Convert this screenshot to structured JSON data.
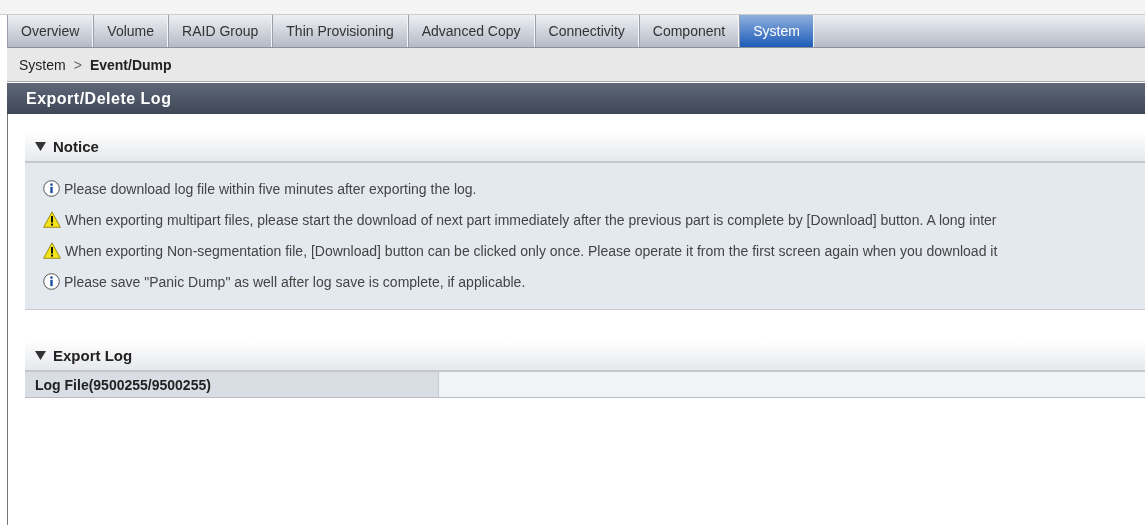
{
  "tabs": [
    {
      "label": "Overview",
      "selected": false
    },
    {
      "label": "Volume",
      "selected": false
    },
    {
      "label": "RAID Group",
      "selected": false
    },
    {
      "label": "Thin Provisioning",
      "selected": false
    },
    {
      "label": "Advanced Copy",
      "selected": false
    },
    {
      "label": "Connectivity",
      "selected": false
    },
    {
      "label": "Component",
      "selected": false
    },
    {
      "label": "System",
      "selected": true
    }
  ],
  "breadcrumb": {
    "parent": "System",
    "separator": ">",
    "current": "Event/Dump"
  },
  "page_title": "Export/Delete Log",
  "notice": {
    "title": "Notice",
    "expanded": true,
    "messages": [
      {
        "kind": "info",
        "text": "Please download log file within five minutes after exporting the log."
      },
      {
        "kind": "warning",
        "text": "When exporting multipart files, please start the download of next part immediately after the previous part is complete by [Download] button. A long inter"
      },
      {
        "kind": "warning",
        "text": "When exporting Non-segmentation file, [Download] button can be clicked only once. Please operate it from the first screen again when you download it"
      },
      {
        "kind": "info",
        "text": "Please save \"Panic Dump\" as well after log save is complete, if applicable."
      }
    ]
  },
  "export_log": {
    "title": "Export Log",
    "expanded": true,
    "rows": [
      {
        "label": "Log File(9500255/9500255)"
      }
    ]
  }
}
